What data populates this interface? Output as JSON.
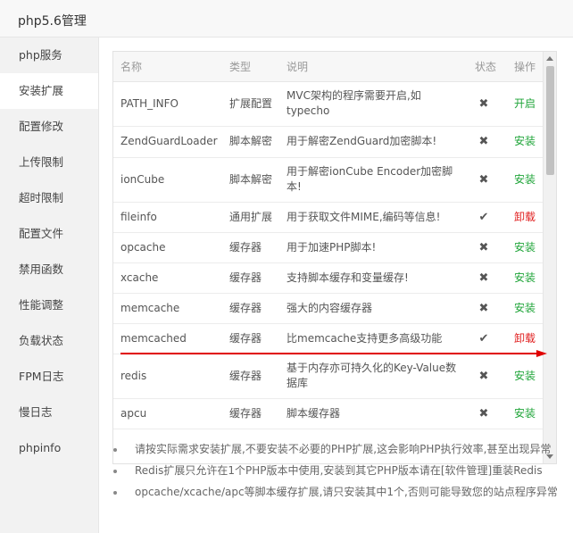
{
  "window": {
    "title": "php5.6管理"
  },
  "sidebar": {
    "items": [
      {
        "label": "php服务"
      },
      {
        "label": "安装扩展",
        "active": true
      },
      {
        "label": "配置修改"
      },
      {
        "label": "上传限制"
      },
      {
        "label": "超时限制"
      },
      {
        "label": "配置文件"
      },
      {
        "label": "禁用函数"
      },
      {
        "label": "性能调整"
      },
      {
        "label": "负载状态"
      },
      {
        "label": "FPM日志"
      },
      {
        "label": "慢日志"
      },
      {
        "label": "phpinfo"
      }
    ]
  },
  "table": {
    "headers": {
      "name": "名称",
      "type": "类型",
      "desc": "说明",
      "status": "状态",
      "action": "操作"
    },
    "rows": [
      {
        "name": "PATH_INFO",
        "type": "扩展配置",
        "desc": "MVC架构的程序需要开启,如typecho",
        "status": "✖",
        "action": "开启",
        "action_color": "green"
      },
      {
        "name": "ZendGuardLoader",
        "type": "脚本解密",
        "desc": "用于解密ZendGuard加密脚本!",
        "status": "✖",
        "action": "安装",
        "action_color": "green"
      },
      {
        "name": "ionCube",
        "type": "脚本解密",
        "desc": "用于解密ionCube Encoder加密脚本!",
        "status": "✖",
        "action": "安装",
        "action_color": "green"
      },
      {
        "name": "fileinfo",
        "type": "通用扩展",
        "desc": "用于获取文件MIME,编码等信息!",
        "status": "✔",
        "action": "卸载",
        "action_color": "red"
      },
      {
        "name": "opcache",
        "type": "缓存器",
        "desc": "用于加速PHP脚本!",
        "status": "✖",
        "action": "安装",
        "action_color": "green"
      },
      {
        "name": "xcache",
        "type": "缓存器",
        "desc": "支持脚本缓存和变量缓存!",
        "status": "✖",
        "action": "安装",
        "action_color": "green"
      },
      {
        "name": "memcache",
        "type": "缓存器",
        "desc": "强大的内容缓存器",
        "status": "✖",
        "action": "安装",
        "action_color": "green"
      },
      {
        "name": "memcached",
        "type": "缓存器",
        "desc": "比memcache支持更多高级功能",
        "status": "✔",
        "action": "卸载",
        "action_color": "red"
      },
      {
        "name": "redis",
        "type": "缓存器",
        "desc": "基于内存亦可持久化的Key-Value数据库",
        "status": "✖",
        "action": "安装",
        "action_color": "green"
      },
      {
        "name": "apcu",
        "type": "缓存器",
        "desc": "脚本缓存器",
        "status": "✖",
        "action": "安装",
        "action_color": "green"
      }
    ]
  },
  "colors": {
    "green": "#20a53a",
    "red": "#e02020",
    "annotation": "#e00000"
  },
  "tips": [
    "请按实际需求安装扩展,不要安装不必要的PHP扩展,这会影响PHP执行效率,甚至出现异常",
    "Redis扩展只允许在1个PHP版本中使用,安装到其它PHP版本请在[软件管理]重装Redis",
    "opcache/xcache/apc等脚本缓存扩展,请只安装其中1个,否则可能导致您的站点程序异常"
  ]
}
